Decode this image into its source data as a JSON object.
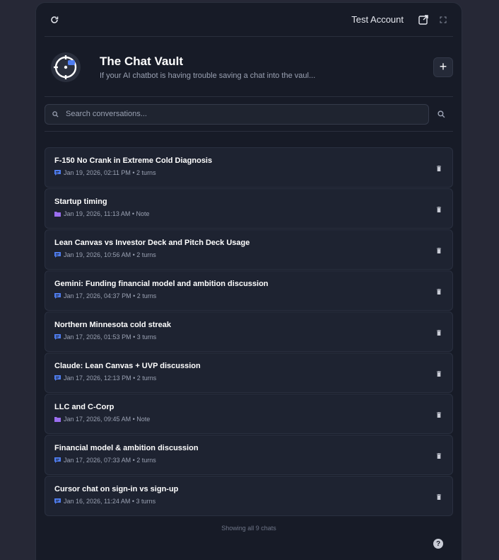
{
  "topbar": {
    "account_label": "Test Account",
    "icons": [
      "refresh-icon",
      "external-link-icon",
      "expand-icon"
    ]
  },
  "header": {
    "title": "The Chat Vault",
    "subtitle": "If your AI chatbot is having trouble saving a chat into the vaul...",
    "add_label": "+"
  },
  "search": {
    "placeholder": "Search conversations..."
  },
  "chats": [
    {
      "title": "F-150 No Crank in Extreme Cold Diagnosis",
      "meta": "Jan 19, 2026, 02:11 PM • 2 turns",
      "kind": "chat"
    },
    {
      "title": "Startup timing",
      "meta": "Jan 19, 2026, 11:13 AM • Note",
      "kind": "note"
    },
    {
      "title": "Lean Canvas vs Investor Deck and Pitch Deck Usage",
      "meta": "Jan 19, 2026, 10:56 AM • 2 turns",
      "kind": "chat"
    },
    {
      "title": "Gemini: Funding financial model and ambition discussion",
      "meta": "Jan 17, 2026, 04:37 PM • 2 turns",
      "kind": "chat"
    },
    {
      "title": "Northern Minnesota cold streak",
      "meta": "Jan 17, 2026, 01:53 PM • 3 turns",
      "kind": "chat"
    },
    {
      "title": "Claude: Lean Canvas + UVP discussion",
      "meta": "Jan 17, 2026, 12:13 PM • 2 turns",
      "kind": "chat"
    },
    {
      "title": "LLC and C-Corp",
      "meta": "Jan 17, 2026, 09:45 AM • Note",
      "kind": "note"
    },
    {
      "title": "Financial model & ambition discussion",
      "meta": "Jan 17, 2026, 07:33 AM • 2 turns",
      "kind": "chat"
    },
    {
      "title": "Cursor chat on sign-in vs sign-up",
      "meta": "Jan 16, 2026, 11:24 AM • 3 turns",
      "kind": "chat"
    }
  ],
  "footer": {
    "status": "Showing all 9 chats",
    "help_label": "?"
  },
  "colors": {
    "background": "#262836",
    "panel": "#171b27",
    "card": "#1e2331",
    "chat_icon": "#4f7df0",
    "note_icon": "#9b6ef0"
  }
}
